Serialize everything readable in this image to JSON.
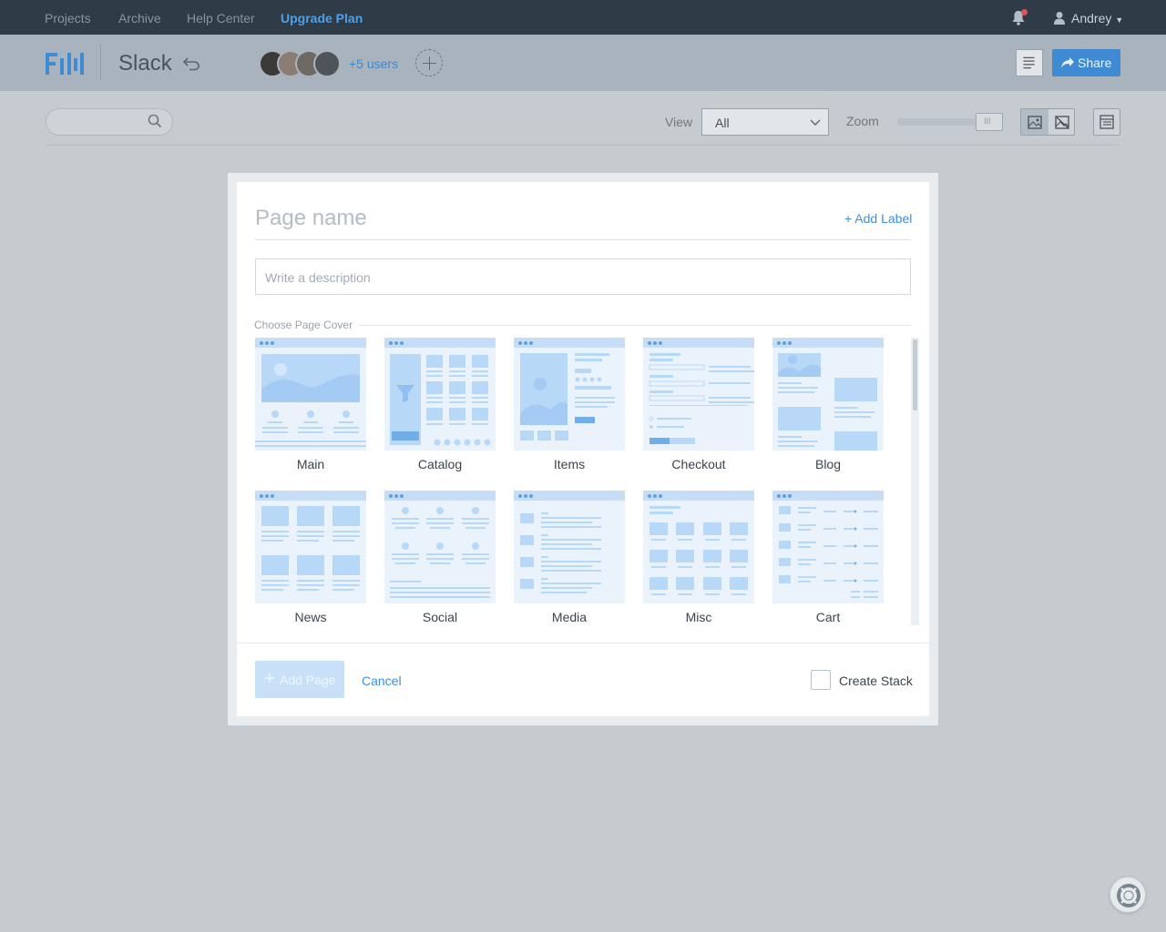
{
  "topnav": {
    "links": [
      "Projects",
      "Archive",
      "Help Center"
    ],
    "upgrade": "Upgrade Plan",
    "user": "Andrey"
  },
  "project": {
    "title": "Slack",
    "more_users": "+5 users",
    "share": "Share"
  },
  "toolbar": {
    "view_label": "View",
    "view_value": "All",
    "zoom_label": "Zoom"
  },
  "modal": {
    "page_name_placeholder": "Page name",
    "add_label": "+ Add Label",
    "description_placeholder": "Write a description",
    "cover_section": "Choose Page Cover",
    "covers": [
      "Main",
      "Catalog",
      "Items",
      "Checkout",
      "Blog",
      "News",
      "Social",
      "Media",
      "Misc",
      "Cart"
    ],
    "add_page": "Add Page",
    "cancel": "Cancel",
    "create_stack": "Create Stack"
  },
  "colors": {
    "nav_bg": "#2f3c48",
    "accent": "#3f8bd3",
    "cover_bg": "#eaf3fc",
    "cover_art": "#b8d8f8"
  }
}
